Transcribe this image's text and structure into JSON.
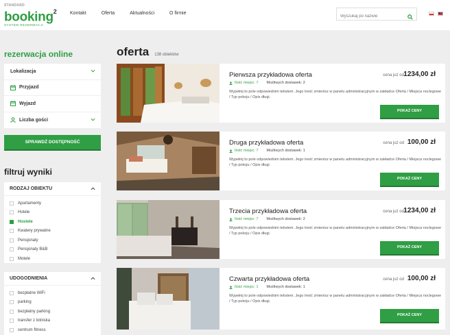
{
  "logo": {
    "top": "STANDARD",
    "main": "booking",
    "sup": "2",
    "sub": "SYSTEM REZERWACJI"
  },
  "nav": [
    "Kontakt",
    "Oferta",
    "Aktualności",
    "O firmie"
  ],
  "search": {
    "placeholder": "Wyszukaj po nazwie",
    "icon": "search-icon"
  },
  "languages": [
    "pl",
    "en"
  ],
  "reservation": {
    "title": "rezerwacja online",
    "fields": [
      {
        "label": "Lokalizacja",
        "icon": "",
        "chevron": true
      },
      {
        "label": "Przyjazd",
        "icon": "calendar-icon",
        "chevron": false
      },
      {
        "label": "Wyjazd",
        "icon": "calendar-icon",
        "chevron": false
      },
      {
        "label": "Liczba gości",
        "icon": "user-icon",
        "chevron": true
      }
    ],
    "button": "SPRAWDŹ DOSTĘPNOŚĆ"
  },
  "filters": {
    "title": "filtruj wyniki",
    "object_type": {
      "header": "RODZAJ OBIEKTU",
      "items": [
        {
          "label": "Apartamenty",
          "checked": false
        },
        {
          "label": "Hotele",
          "checked": false
        },
        {
          "label": "Hostele",
          "checked": true
        },
        {
          "label": "Kwatery prywatne",
          "checked": false
        },
        {
          "label": "Pensjonaty",
          "checked": false
        },
        {
          "label": "Pensjonaty B&B",
          "checked": false
        },
        {
          "label": "Motele",
          "checked": false
        }
      ]
    },
    "amenities": {
      "header": "UDOGODNIENIA",
      "items": [
        {
          "label": "bezpłatne WiFi",
          "checked": false
        },
        {
          "label": "parking",
          "checked": false
        },
        {
          "label": "bezpłatny parking",
          "checked": false
        },
        {
          "label": "transfer z lotniska",
          "checked": false
        },
        {
          "label": "centrum fitness",
          "checked": false
        }
      ]
    }
  },
  "main": {
    "title": "oferta",
    "count": "138 obiektów"
  },
  "offers": [
    {
      "name": "Pierwsza przykładowa oferta",
      "price_label": "cena już od",
      "price": "1234,00 zł",
      "places": "Ilość miejsc: 7",
      "suppliers": "Możliwych dostawek: 2",
      "desc": "Wypełnij to pole odpowiednim tekstem.  Jego treść zmienisz w panelu administracyjnym w zakładce Oferta / Miejsca noclegowe / Typ pokoju / Opis długi.",
      "button": "POKAŻ CENY"
    },
    {
      "name": "Druga przykładowa oferta",
      "price_label": "cena już od",
      "price": "100,00 zł",
      "places": "Ilość miejsc: 7",
      "suppliers": "Możliwych dostawek: 1",
      "desc": "Wypełnij to pole odpowiednim tekstem.  Jego treść zmienisz w panelu administracyjnym w zakładce Oferta / Miejsca noclegowe / Typ pokoju / Opis długi.",
      "button": "POKAŻ CENY"
    },
    {
      "name": "Trzecia przykładowa oferta",
      "price_label": "cena już od",
      "price": "1234,00 zł",
      "places": "Ilość miejsc: 7",
      "suppliers": "Możliwych dostawek: 2",
      "desc": "Wypełnij to pole odpowiednim tekstem.  Jego treść zmienisz w panelu administracyjnym w zakładce Oferta / Miejsca noclegowe / Typ pokoju / Opis długi.",
      "button": "POKAŻ CENY"
    },
    {
      "name": "Czwarta przykładowa oferta",
      "price_label": "cena już od",
      "price": "100,00 zł",
      "places": "Ilość miejsc: 1",
      "suppliers": "Możliwych dostawek: 1",
      "desc": "Wypełnij to pole odpowiednim tekstem.  Jego treść zmienisz w panelu administracyjnym w zakładce Oferta / Miejsca noclegowe / Typ pokoju / Opis długi.",
      "button": "POKAŻ CENY"
    }
  ],
  "colors": {
    "accent": "#2f9e44",
    "background": "#eeeeee"
  }
}
